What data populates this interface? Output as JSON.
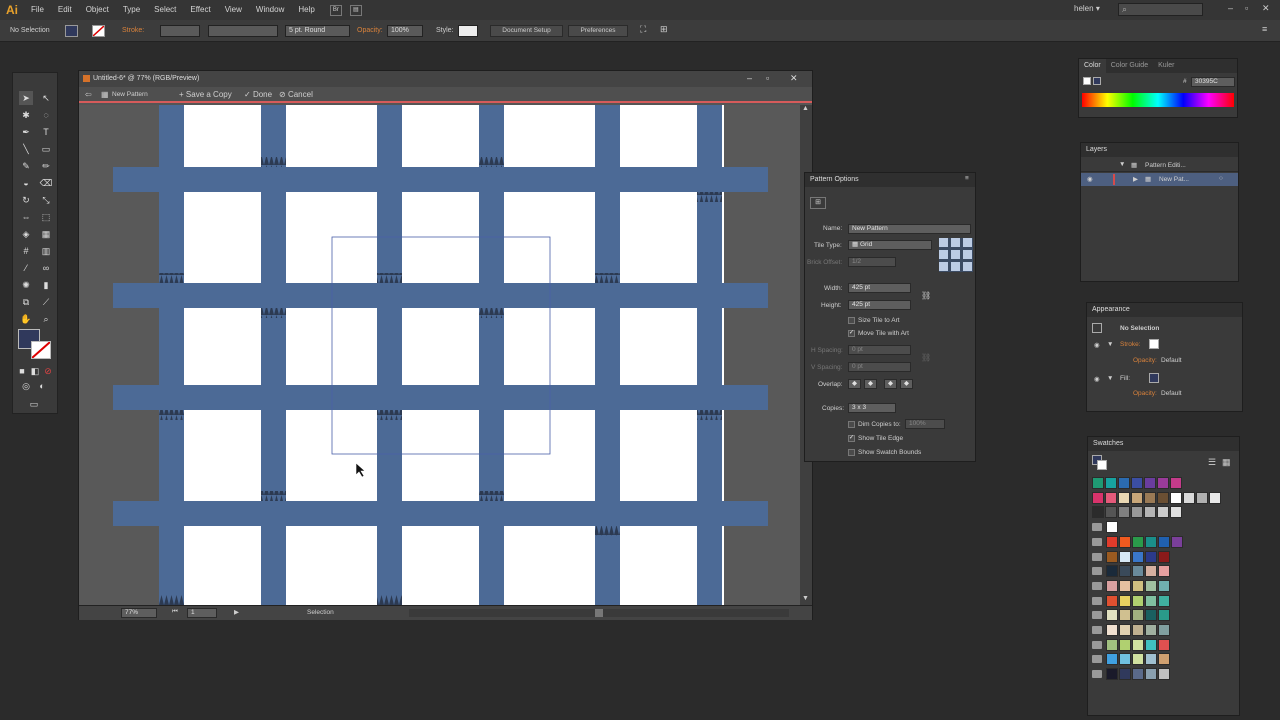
{
  "app": {
    "logo": "Ai"
  },
  "menu": [
    "File",
    "Edit",
    "Object",
    "Type",
    "Select",
    "Effect",
    "View",
    "Window",
    "Help"
  ],
  "menubar_extra": {
    "bridge": "Br",
    "user": "helen",
    "user_caret": "▾"
  },
  "controlbar": {
    "selection": "No Selection",
    "stroke_label": "Stroke:",
    "brush": "5 pt. Round",
    "opacity_label": "Opacity:",
    "opacity_value": "100%",
    "style_label": "Style:",
    "document_setup": "Document Setup",
    "preferences": "Preferences"
  },
  "document": {
    "title": "Untitled-6* @ 77% (RGB/Preview)",
    "iso_name": "New Pattern",
    "save_copy": "Save a Copy",
    "done": "Done",
    "cancel": "Cancel",
    "zoom": "77%",
    "artboard": "1",
    "status": "Selection"
  },
  "pattern_options": {
    "title": "Pattern Options",
    "name_label": "Name:",
    "name_value": "New Pattern",
    "tile_type_label": "Tile Type:",
    "tile_type_value": "Grid",
    "brick_offset_label": "Brick Offset:",
    "brick_offset_value": "1/2",
    "width_label": "Width:",
    "width_value": "425 pt",
    "height_label": "Height:",
    "height_value": "425 pt",
    "size_tile": "Size Tile to Art",
    "move_tile": "Move Tile with Art",
    "h_spacing_label": "H Spacing:",
    "h_spacing_value": "0 pt",
    "v_spacing_label": "V Spacing:",
    "v_spacing_value": "0 pt",
    "overlap_label": "Overlap:",
    "copies_label": "Copies:",
    "copies_value": "3 x 3",
    "dim_copies": "Dim Copies to:",
    "dim_value": "100%",
    "show_tile_edge": "Show Tile Edge",
    "show_swatch_bounds": "Show Swatch Bounds"
  },
  "color_panel": {
    "tabs": [
      "Color",
      "Color Guide",
      "Kuler"
    ],
    "hex_label": "#",
    "hex": "30395C"
  },
  "layers_panel": {
    "title": "Layers",
    "rows": [
      "Pattern Editi...",
      "New Pat..."
    ]
  },
  "appearance_panel": {
    "title": "Appearance",
    "selection": "No Selection",
    "stroke": "Stroke:",
    "opacity": "Opacity:",
    "opacity_value": "Default",
    "fill": "Fill:",
    "opacity2": "Opacity:",
    "opacity2_value": "Default"
  },
  "swatches_panel": {
    "title": "Swatches"
  },
  "colors": {
    "pattern_blue": "#4c6a96",
    "tile_edge": "#4a5fa8",
    "iso_red": "#d65b5b",
    "accent_orange": "#d9823b"
  }
}
